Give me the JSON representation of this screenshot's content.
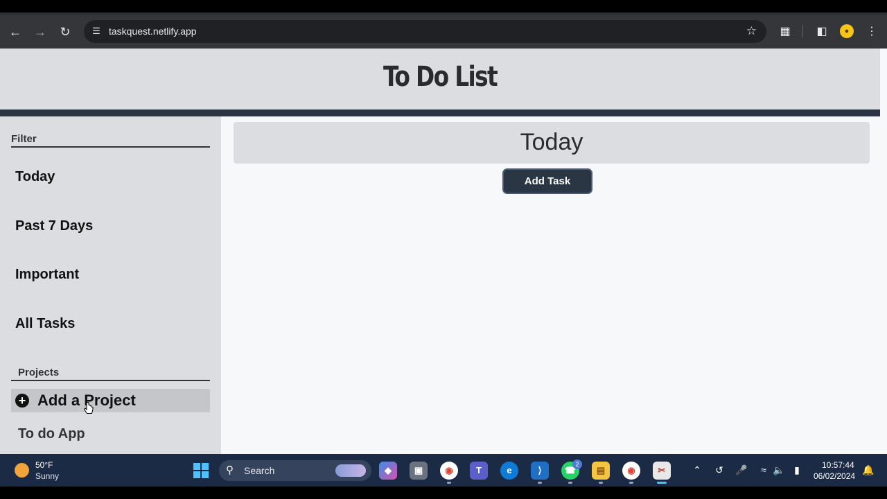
{
  "browser": {
    "url": "taskquest.netlify.app",
    "icons": {
      "back": "back-arrow-icon",
      "forward": "forward-arrow-icon",
      "reload": "reload-icon",
      "site_info": "site-settings-icon",
      "bookmark": "star-icon",
      "extensions": "puzzle-icon",
      "side_panel": "side-panel-icon",
      "menu": "kebab-menu-icon"
    }
  },
  "app": {
    "title": "To Do List",
    "accent_color": "#2b3645",
    "sidebar": {
      "filter_heading": "Filter",
      "filters": [
        {
          "label": "Today"
        },
        {
          "label": "Past 7 Days"
        },
        {
          "label": "Important"
        },
        {
          "label": "All Tasks"
        }
      ],
      "projects_heading": "Projects",
      "add_project_label": "Add a Project",
      "projects": [
        {
          "label": "To do App"
        }
      ]
    },
    "main": {
      "view_title": "Today",
      "add_task_label": "Add Task"
    }
  },
  "taskbar": {
    "weather": {
      "temp": "50°F",
      "condition": "Sunny"
    },
    "search_label": "Search",
    "whatsapp_badge": "2",
    "clock": {
      "time": "10:57:44",
      "date": "06/02/2024"
    }
  }
}
